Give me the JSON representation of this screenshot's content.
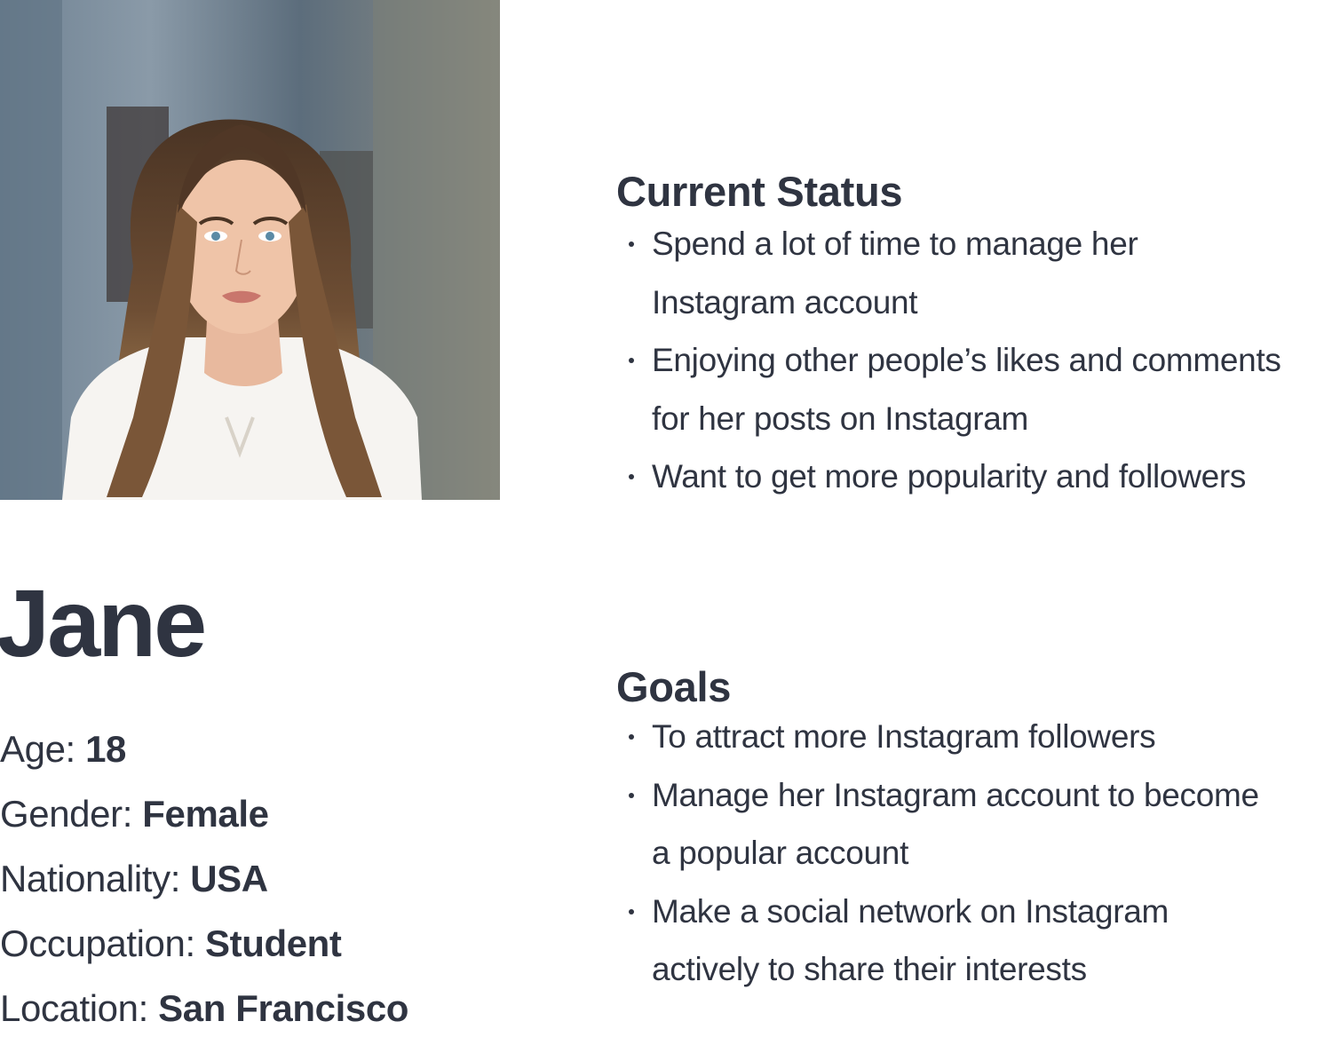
{
  "persona": {
    "name": "Jane",
    "photo_icon": "portrait-photo",
    "facts": [
      {
        "label": "Age: ",
        "value": "18"
      },
      {
        "label": "Gender: ",
        "value": "Female"
      },
      {
        "label": "Nationality: ",
        "value": "USA"
      },
      {
        "label": "Occupation: ",
        "value": "Student"
      },
      {
        "label": "Location: ",
        "value": "San Francisco"
      }
    ]
  },
  "current_status": {
    "title": "Current Status",
    "items": [
      {
        "line1": "Spend a lot of time to manage her",
        "line2": "Instagram account"
      },
      {
        "line1": "Enjoying other people’s likes and comments",
        "line2": "for her posts on Instagram"
      },
      {
        "line1": "Want to get more popularity and followers"
      }
    ]
  },
  "goals": {
    "title": "Goals",
    "items": [
      {
        "line1": "To attract more Instagram followers"
      },
      {
        "line1": "Manage her Instagram account to become",
        "line2": "a popular account"
      },
      {
        "line1": "Make a social network on Instagram",
        "line2": "actively to share their interests"
      }
    ]
  },
  "colors": {
    "text": "#2f3441",
    "background": "#ffffff"
  }
}
